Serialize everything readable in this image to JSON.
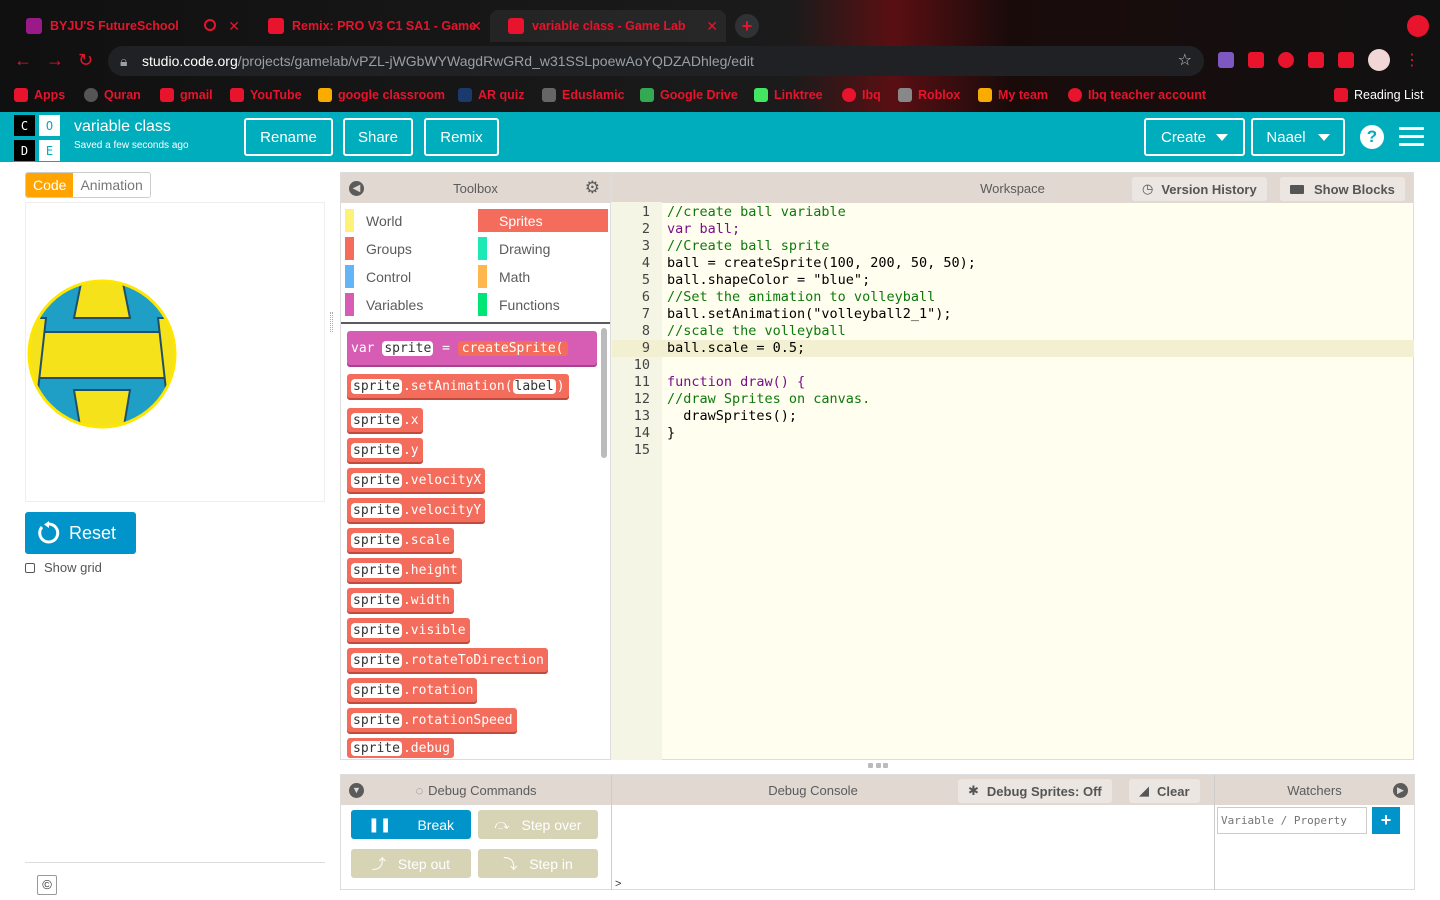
{
  "browser": {
    "tabs": [
      {
        "title": "BYJU'S FutureSchool"
      },
      {
        "title": "Remix: PRO V3 C1 SA1 - Game"
      },
      {
        "title": "variable class - Game Lab"
      }
    ],
    "url_host": "studio.code.org",
    "url_path": "/projects/gamelab/vPZL-jWGbWYWagdRwGRd_w31SSLpoewAoYQDZADhleg/edit",
    "bookmarks": [
      "Apps",
      "Quran",
      "gmail",
      "YouTube",
      "google classroom",
      "AR quiz",
      "Eduslamic",
      "Google Drive",
      "Linktree",
      "Ibq",
      "Roblox",
      "My team",
      "Ibq teacher account"
    ],
    "reading_list": "Reading List"
  },
  "header": {
    "logo_letters": [
      "C",
      "O",
      "D",
      "E"
    ],
    "project_title": "variable class",
    "saved_status": "Saved a few seconds ago",
    "rename_label": "Rename",
    "share_label": "Share",
    "remix_label": "Remix",
    "create_label": "Create",
    "user_label": "Naael",
    "help_label": "?"
  },
  "left": {
    "code_tab": "Code",
    "animation_tab": "Animation",
    "reset_label": "Reset",
    "show_grid_label": "Show grid",
    "copyright": "©"
  },
  "toolbox": {
    "title": "Toolbox",
    "categories": [
      {
        "label": "World",
        "color": "#fff176"
      },
      {
        "label": "Sprites",
        "color": "#f36c5c"
      },
      {
        "label": "Groups",
        "color": "#f36c5c"
      },
      {
        "label": "Drawing",
        "color": "#1de9b6"
      },
      {
        "label": "Control",
        "color": "#64b5f6"
      },
      {
        "label": "Math",
        "color": "#ffb74d"
      },
      {
        "label": "Variables",
        "color": "#d65cb4"
      },
      {
        "label": "Functions",
        "color": "#00e676"
      }
    ],
    "var_block": {
      "kw": "var",
      "name": "sprite",
      "eq": "=",
      "call": "createSprite("
    },
    "blocks": [
      {
        "obj": "sprite",
        "member": ".setAnimation(",
        "arg": "label",
        "close": ")"
      },
      {
        "obj": "sprite",
        "member": ".x"
      },
      {
        "obj": "sprite",
        "member": ".y"
      },
      {
        "obj": "sprite",
        "member": ".velocityX"
      },
      {
        "obj": "sprite",
        "member": ".velocityY"
      },
      {
        "obj": "sprite",
        "member": ".scale"
      },
      {
        "obj": "sprite",
        "member": ".height"
      },
      {
        "obj": "sprite",
        "member": ".width"
      },
      {
        "obj": "sprite",
        "member": ".visible"
      },
      {
        "obj": "sprite",
        "member": ".rotateToDirection"
      },
      {
        "obj": "sprite",
        "member": ".rotation"
      },
      {
        "obj": "sprite",
        "member": ".rotationSpeed"
      },
      {
        "obj": "sprite",
        "member": ".debug"
      }
    ]
  },
  "workspace": {
    "title": "Workspace",
    "version_history_label": "Version History",
    "show_blocks_label": "Show Blocks",
    "code_lines": [
      {
        "n": "1",
        "text": "//create ball variable",
        "cls": "c-com"
      },
      {
        "n": "2",
        "text": "var ball;",
        "cls": "c-kw"
      },
      {
        "n": "3",
        "text": "//Create ball sprite",
        "cls": "c-com"
      },
      {
        "n": "4",
        "text": "ball = createSprite(100, 200, 50, 50);",
        "cls": "c-def"
      },
      {
        "n": "5",
        "text": "ball.shapeColor = \"blue\";",
        "cls": "c-def"
      },
      {
        "n": "6",
        "text": "//Set the animation to volleyball",
        "cls": "c-com"
      },
      {
        "n": "7",
        "text": "ball.setAnimation(\"volleyball2_1\");",
        "cls": "c-def"
      },
      {
        "n": "8",
        "text": "//scale the volleyball",
        "cls": "c-com"
      },
      {
        "n": "9",
        "text": "ball.scale = 0.5;",
        "cls": "c-def"
      },
      {
        "n": "10",
        "text": "",
        "cls": "c-def"
      },
      {
        "n": "11",
        "text": "function draw() {",
        "cls": "c-kw"
      },
      {
        "n": "12",
        "text": "//draw Sprites on canvas.",
        "cls": "c-com"
      },
      {
        "n": "13",
        "text": "  drawSprites();",
        "cls": "c-def"
      },
      {
        "n": "14",
        "text": "}",
        "cls": "c-def"
      },
      {
        "n": "15",
        "text": "",
        "cls": "c-def"
      }
    ]
  },
  "debug": {
    "commands_title": "Debug Commands",
    "break_label": "Break",
    "step_over_label": "Step over",
    "step_out_label": "Step out",
    "step_in_label": "Step in",
    "console_title": "Debug Console",
    "debug_sprites_label": "Debug Sprites: Off",
    "clear_label": "Clear",
    "prompt": ">",
    "watchers_title": "Watchers",
    "watch_placeholder": "Variable / Property",
    "add_label": "+"
  }
}
